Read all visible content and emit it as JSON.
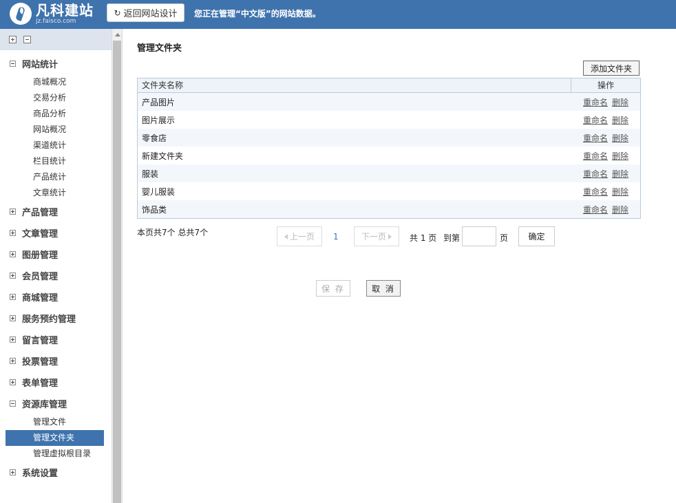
{
  "header": {
    "logo_name": "凡科建站",
    "logo_url": "jz.faisco.com",
    "back_button": "返回网站设计",
    "notice": "您正在管理“中文版”的网站数据。"
  },
  "sidebar": {
    "groups": [
      {
        "label": "网站统计",
        "expanded": true,
        "items": [
          "商城概况",
          "交易分析",
          "商品分析",
          "网站概况",
          "渠道统计",
          "栏目统计",
          "产品统计",
          "文章统计"
        ]
      },
      {
        "label": "产品管理",
        "expanded": false
      },
      {
        "label": "文章管理",
        "expanded": false
      },
      {
        "label": "图册管理",
        "expanded": false
      },
      {
        "label": "会员管理",
        "expanded": false
      },
      {
        "label": "商城管理",
        "expanded": false
      },
      {
        "label": "服务预约管理",
        "expanded": false
      },
      {
        "label": "留言管理",
        "expanded": false
      },
      {
        "label": "投票管理",
        "expanded": false
      },
      {
        "label": "表单管理",
        "expanded": false
      },
      {
        "label": "资源库管理",
        "expanded": true,
        "items": [
          "管理文件",
          "管理文件夹",
          "管理虚拟根目录"
        ]
      },
      {
        "label": "系统设置",
        "expanded": false
      }
    ],
    "active_item": "管理文件夹"
  },
  "main": {
    "title": "管理文件夹",
    "add_button": "添加文件夹",
    "table": {
      "columns": [
        "文件夹名称",
        "操作"
      ],
      "rows": [
        "产品图片",
        "图片展示",
        "零食店",
        "新建文件夹",
        "服装",
        "婴儿服装",
        "饰品类"
      ],
      "actions": [
        "重命名",
        "删除"
      ]
    },
    "summary": "本页共7个 总共7个",
    "pager": {
      "prev": "上一页",
      "current": "1",
      "next": "下一页",
      "total": "共 1 页",
      "goto": "到第",
      "unit": "页",
      "confirm": "确定"
    },
    "save": "保 存",
    "cancel": "取 消"
  },
  "colors": {
    "brand": "#3f73ad",
    "active_bg": "#3f73ad"
  }
}
